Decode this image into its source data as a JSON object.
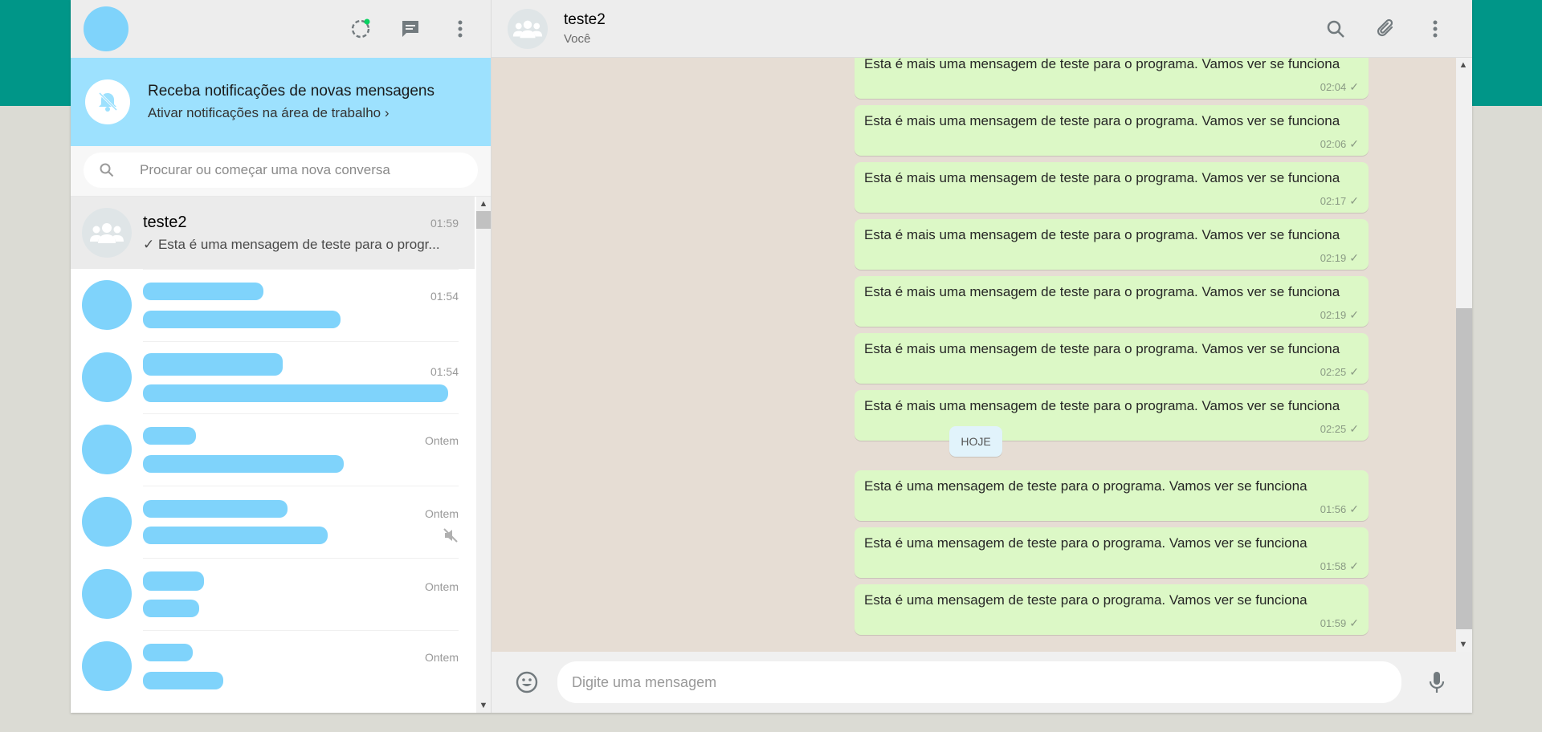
{
  "sidebar": {
    "notification": {
      "title": "Receba notificações de novas mensagens",
      "link": "Ativar notificações na área de trabalho ›"
    },
    "search": {
      "placeholder": "Procurar ou começar uma nova conversa"
    },
    "chats": [
      {
        "name": "teste2",
        "time": "01:59",
        "preview": "✓ Esta é uma mensagem de teste para o progr...",
        "active": true
      },
      {
        "time": "01:54"
      },
      {
        "time": "01:54"
      },
      {
        "time": "Ontem"
      },
      {
        "time": "Ontem",
        "muted": true
      },
      {
        "time": "Ontem"
      },
      {
        "time": "Ontem"
      }
    ]
  },
  "conversation": {
    "name": "teste2",
    "subtitle": "Você",
    "date_chip": "HOJE",
    "messages_before": [
      {
        "text": "Esta é mais uma mensagem de teste para o programa. Vamos ver se funciona",
        "time": "02:04"
      },
      {
        "text": "Esta é mais uma mensagem de teste para o programa. Vamos ver se funciona",
        "time": "02:06"
      },
      {
        "text": "Esta é mais uma mensagem de teste para o programa. Vamos ver se funciona",
        "time": "02:17"
      },
      {
        "text": "Esta é mais uma mensagem de teste para o programa. Vamos ver se funciona",
        "time": "02:19"
      },
      {
        "text": "Esta é mais uma mensagem de teste para o programa. Vamos ver se funciona",
        "time": "02:19"
      },
      {
        "text": "Esta é mais uma mensagem de teste para o programa. Vamos ver se funciona",
        "time": "02:25"
      },
      {
        "text": "Esta é mais uma mensagem de teste para o programa. Vamos ver se funciona",
        "time": "02:25"
      }
    ],
    "messages_today": [
      {
        "text": "Esta é uma mensagem de teste para o programa. Vamos ver se funciona",
        "time": "01:56"
      },
      {
        "text": "Esta é uma mensagem de teste para o programa. Vamos ver se funciona",
        "time": "01:58"
      },
      {
        "text": "Esta é uma mensagem de teste para o programa. Vamos ver se funciona",
        "time": "01:59"
      }
    ]
  },
  "composer": {
    "placeholder": "Digite uma mensagem"
  },
  "colors": {
    "accent": "#009688",
    "bubble": "#dcf8c6",
    "notification_bg": "#9de1fe"
  },
  "icons": [
    "status-icon",
    "new-chat-icon",
    "menu-icon",
    "bell-off-icon",
    "search-icon",
    "attach-icon",
    "emoji-icon",
    "mic-icon",
    "mute-icon",
    "group-icon"
  ]
}
